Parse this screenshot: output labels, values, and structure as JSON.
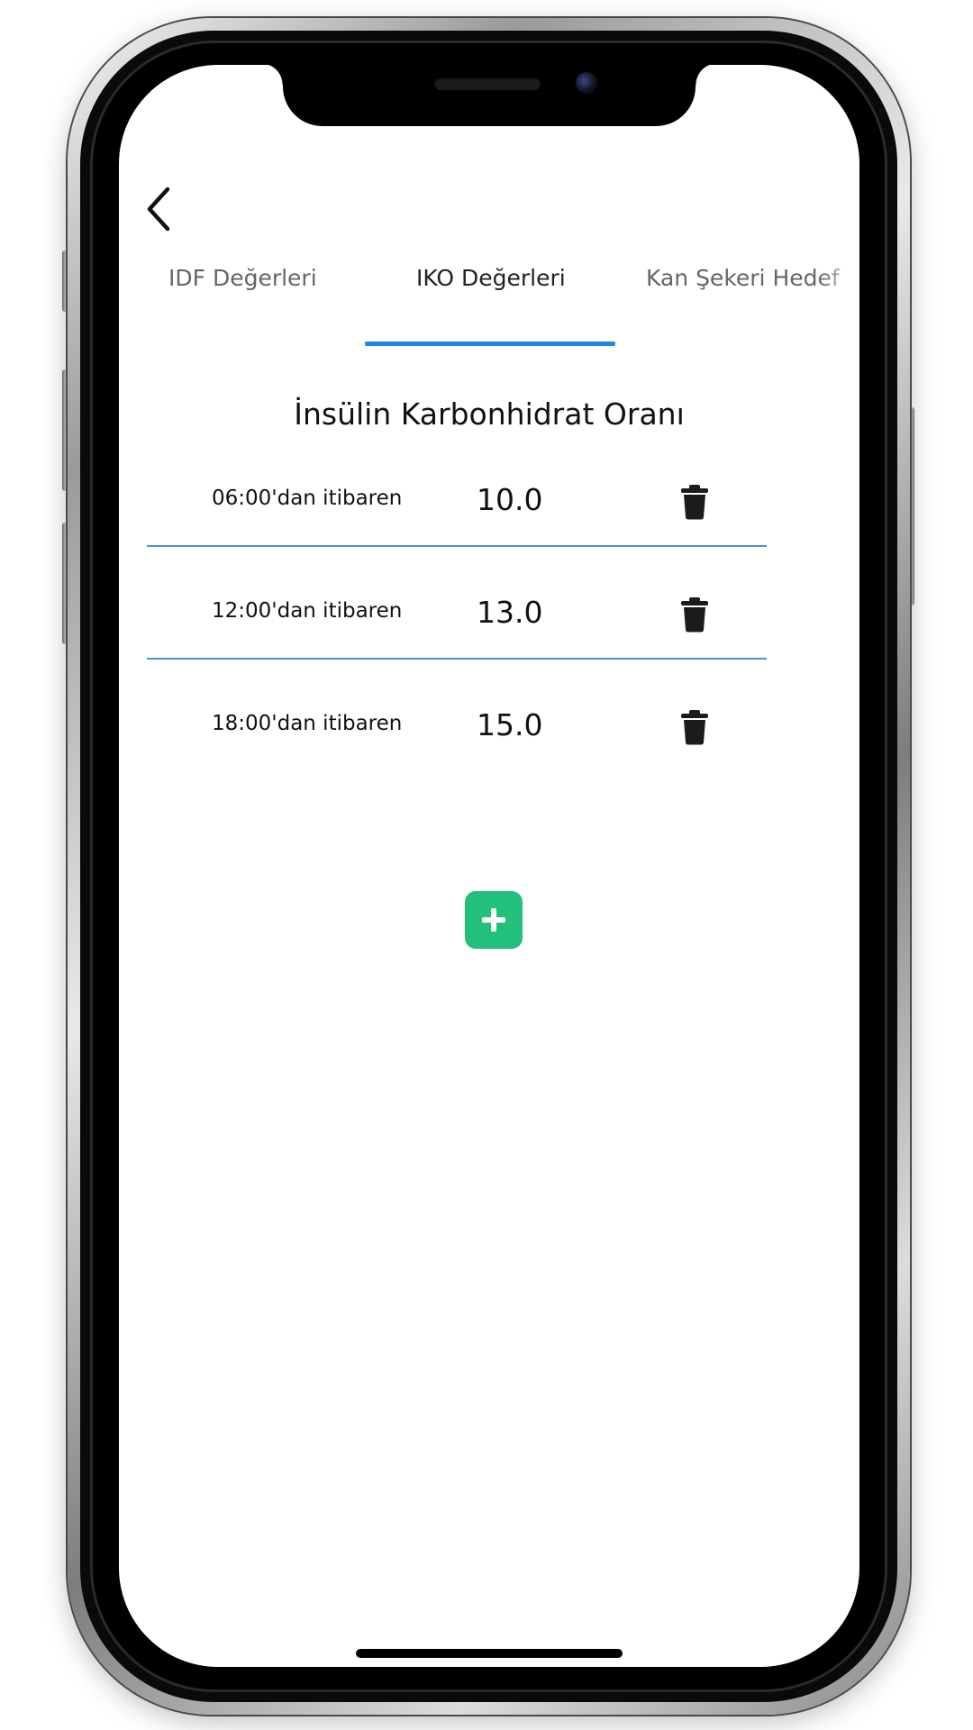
{
  "tabs": [
    {
      "label": "IDF Değerleri",
      "active": false
    },
    {
      "label": "IKO Değerleri",
      "active": true
    },
    {
      "label": "Kan Şekeri Hedef",
      "active": false
    }
  ],
  "page": {
    "title": "İnsülin Karbonhidrat Oranı"
  },
  "ratios": [
    {
      "time": "06:00'dan itibaren",
      "value": "10.0"
    },
    {
      "time": "12:00'dan itibaren",
      "value": "13.0"
    },
    {
      "time": "18:00'dan itibaren",
      "value": "15.0"
    }
  ],
  "icons": {
    "back": "chevron-left-icon",
    "delete": "trash-icon",
    "add": "plus-icon"
  },
  "colors": {
    "accent": "#1e88e5",
    "divider": "#4a8fe0",
    "add_button": "#22c07a",
    "text_primary": "#111111",
    "text_inactive": "#666666"
  }
}
